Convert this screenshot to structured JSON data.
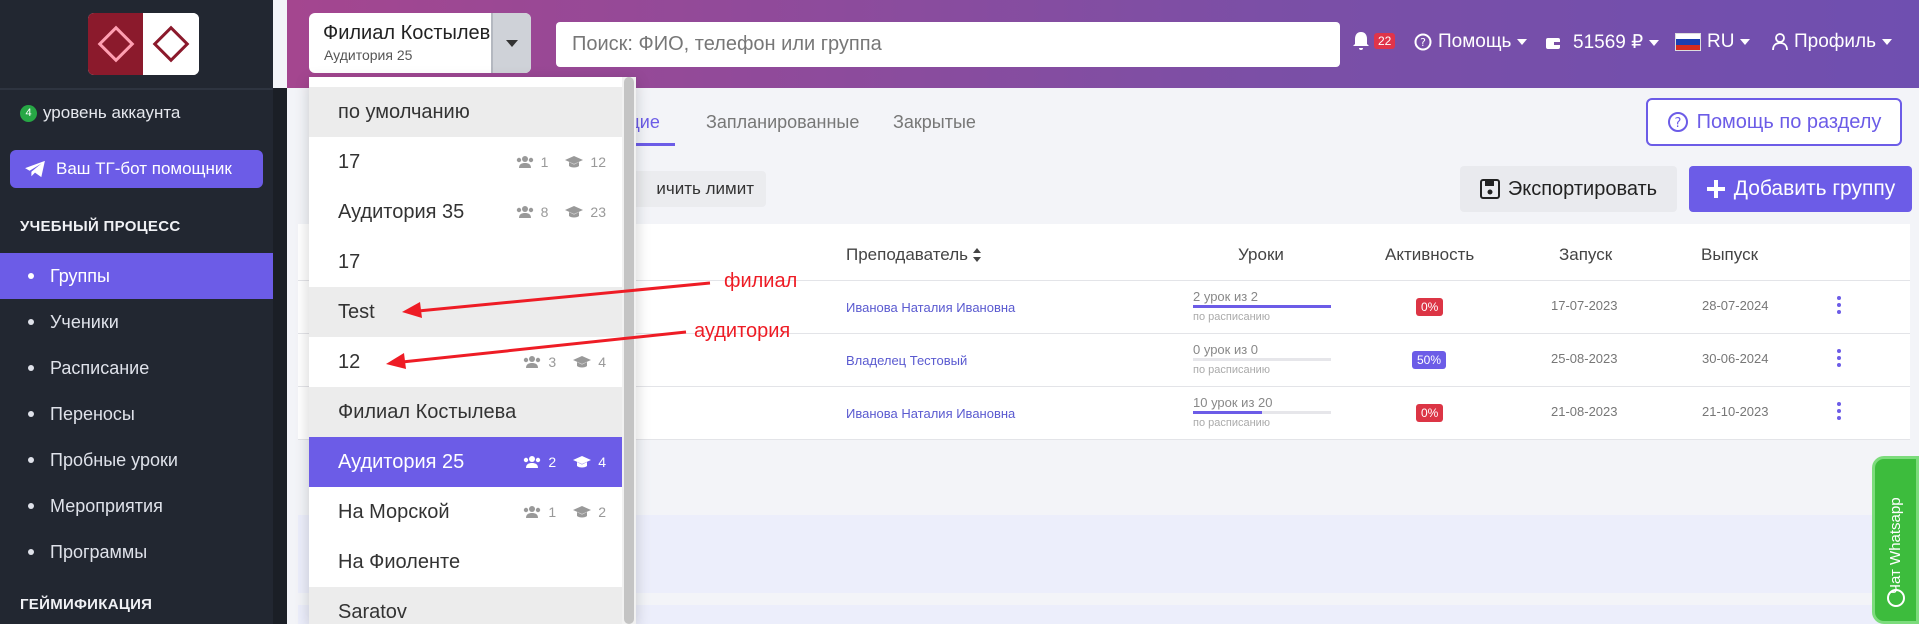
{
  "sidebar": {
    "account_level_badge": "4",
    "account_level_text": "уровень аккаунта",
    "tg_button": "Ваш ТГ-бот помощник",
    "section_learning": "УЧЕБНЫЙ ПРОЦЕСС",
    "section_gamification": "ГЕЙМИФИКАЦИЯ",
    "items": [
      {
        "label": "Группы",
        "active": true
      },
      {
        "label": "Ученики",
        "active": false
      },
      {
        "label": "Расписание",
        "active": false
      },
      {
        "label": "Переносы",
        "active": false
      },
      {
        "label": "Пробные уроки",
        "active": false
      },
      {
        "label": "Мероприятия",
        "active": false
      },
      {
        "label": "Программы",
        "active": false
      }
    ]
  },
  "header": {
    "branch_main": "Филиал Костылева",
    "branch_sub": "Аудитория 25",
    "search_placeholder": "Поиск: ФИО, телефон или группа",
    "notifications": "22",
    "help": "Помощь",
    "balance": "51569 ₽",
    "lang": "RU",
    "profile": "Профиль"
  },
  "tabs": {
    "current_partial": "щие",
    "planned": "Запланированные",
    "closed": "Закрытые"
  },
  "help_section_button": "Помощь по разделу",
  "limit_button_partial": "ичить лимит",
  "export_button": "Экспортировать",
  "add_group_button": "Добавить группу",
  "table": {
    "headers": {
      "teacher": "Преподаватель",
      "lessons": "Уроки",
      "activity": "Активность",
      "launch": "Запуск",
      "release": "Выпуск"
    },
    "rows": [
      {
        "teacher": "Иванова Наталия Ивановна",
        "lessons": "2 урок из 2",
        "lessons_sub": "по расписанию",
        "progress": 1.0,
        "activity": "0%",
        "activity_color": "#dc3545",
        "launch": "17-07-2023",
        "release": "28-07-2024"
      },
      {
        "teacher": "Владелец Тестовый",
        "lessons": "0 урок из 0",
        "lessons_sub": "по расписанию",
        "progress": 0.0,
        "activity": "50%",
        "activity_color": "#6c5ce7",
        "launch": "25-08-2023",
        "release": "30-06-2024"
      },
      {
        "teacher": "Иванова Наталия Ивановна",
        "lessons": "10 урок из 20",
        "lessons_sub": "по расписанию",
        "progress": 0.5,
        "activity": "0%",
        "activity_color": "#dc3545",
        "launch": "21-08-2023",
        "release": "21-10-2023"
      }
    ]
  },
  "dropdown": {
    "items": [
      {
        "label": "по умолчанию",
        "type": "group"
      },
      {
        "label": "17",
        "type": "item",
        "students": "1",
        "teachers": "12"
      },
      {
        "label": "Аудитория 35",
        "type": "item",
        "students": "8",
        "teachers": "23"
      },
      {
        "label": "17",
        "type": "item"
      },
      {
        "label": "Test",
        "type": "group"
      },
      {
        "label": "12",
        "type": "item",
        "students": "3",
        "teachers": "4"
      },
      {
        "label": "Филиал Костылева",
        "type": "group"
      },
      {
        "label": "Аудитория 25",
        "type": "selected",
        "students": "2",
        "teachers": "4"
      },
      {
        "label": "На Морской",
        "type": "item",
        "students": "1",
        "teachers": "2"
      },
      {
        "label": "На Фиоленте",
        "type": "item"
      },
      {
        "label": "Saratov",
        "type": "group"
      }
    ]
  },
  "annotations": {
    "branch": "филиал",
    "room": "аудитория"
  },
  "whatsapp": "Чат Whatsapp",
  "colors": {
    "accent": "#6c5ce7",
    "sidebar": "#222731",
    "annotation": "#ee1c25"
  }
}
